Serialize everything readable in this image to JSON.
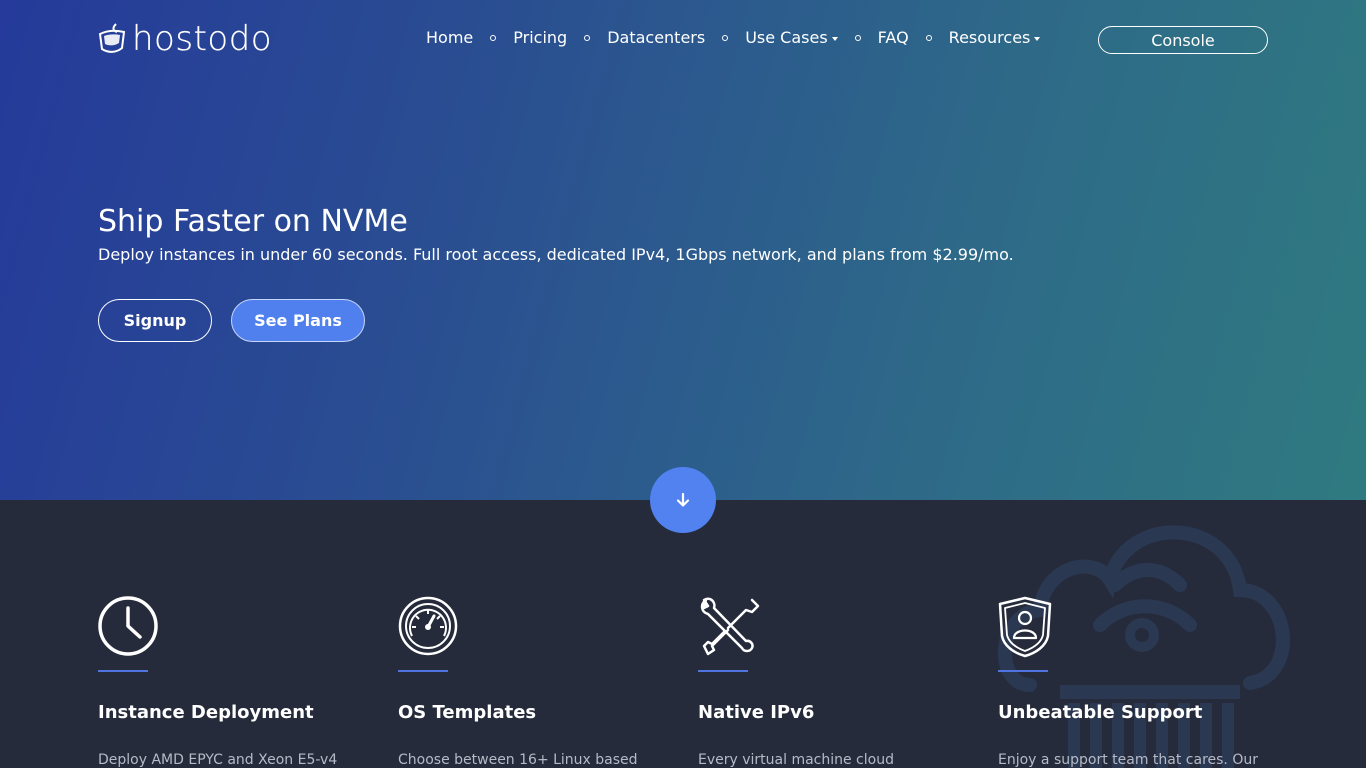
{
  "brand": {
    "name": "hostodo",
    "logo_icon": "shield-logo-icon"
  },
  "nav": {
    "items": [
      {
        "label": "Home",
        "dropdown": false
      },
      {
        "label": "Pricing",
        "dropdown": false
      },
      {
        "label": "Datacenters",
        "dropdown": false
      },
      {
        "label": "Use Cases",
        "dropdown": true
      },
      {
        "label": "FAQ",
        "dropdown": false
      },
      {
        "label": "Resources",
        "dropdown": true
      }
    ],
    "console_label": "Console"
  },
  "hero": {
    "title": "Ship Faster on NVMe",
    "subtitle": "Deploy instances in under 60 seconds. Full root access, dedicated IPv4, 1Gbps network, and plans from $2.99/mo.",
    "signup_label": "Signup",
    "plans_label": "See Plans",
    "scroll_icon": "arrow-down-icon"
  },
  "features": [
    {
      "icon": "clock-icon",
      "title": "Instance Deployment",
      "text": "Deploy AMD EPYC and Xeon E5-v4"
    },
    {
      "icon": "speedometer-icon",
      "title": "OS Templates",
      "text": "Choose between 16+ Linux based"
    },
    {
      "icon": "wrench-screwdriver-icon",
      "title": "Native IPv6",
      "text": "Every virtual machine cloud"
    },
    {
      "icon": "user-shield-icon",
      "title": "Unbeatable Support",
      "text": "Enjoy a support team that cares. Our"
    }
  ],
  "colors": {
    "hero_gradient_start": "#253a9a",
    "hero_gradient_end": "#2f7a80",
    "accent": "#5182f0",
    "features_bg": "#252b3b"
  }
}
